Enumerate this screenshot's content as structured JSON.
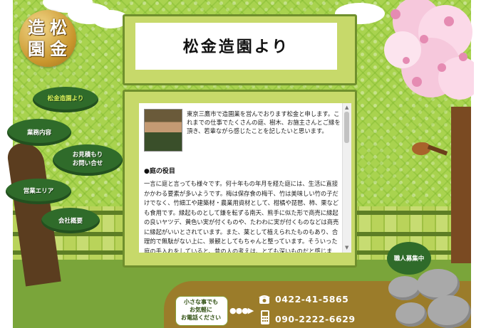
{
  "logo": {
    "chars": [
      "造",
      "松",
      "園",
      "金"
    ]
  },
  "header": {
    "title": "松金造園より"
  },
  "nav": {
    "items": [
      {
        "label": "松金造園より",
        "active": true
      },
      {
        "label": "業務内容"
      },
      {
        "label": "お見積もり\nお問い合せ"
      },
      {
        "label": "営業エリア"
      },
      {
        "label": "会社概要"
      }
    ]
  },
  "content": {
    "intro": "東京三鷹市で造園業を営んでおります松金と申します。これまでの仕事でたくさんの庭、樹木、お施主さんとご縁を頂き、若輩ながら感じたことを記したいと思います。",
    "section_title": "●庭の役目",
    "body": "一言に庭と言っても様々です。何十年もの年月を経た庭には、生活に直接かかわる要素が多いようです。梅は保存食の梅干、竹は美味しい竹の子だけでなく、竹細工や建築材・農業用資材として、柑橘や琵琶、柿、栗なども食用です。縁起ものとして鎌を転ずる南天、熊手に似た形で商売に縁起の良いヤツデ、黄色い実が付くものや、たわわに実が付くものなどは商売に縁起がいいとされています。また、薬として植えられたものもあり、合理的で無駄がない上に、景観としてもちゃんと整っています。そういった庭の手入れをしていると、昔の人の考えは、とても深いものだと感じます。"
  },
  "recruit": {
    "label": "職人募集中"
  },
  "contact": {
    "bubble": "小さな事でも\nお気軽に\nお電話ください",
    "tel": "0422-41-5865",
    "mobile": "090-2222-6629"
  },
  "icons": {
    "phone": "telephone-icon",
    "mobile": "mobile-phone-icon",
    "arrow": "arrow-right-icon"
  },
  "colors": {
    "grass": "#a9d34f",
    "nav_green": "#2f6b2a",
    "nav_active": "#d9f25a",
    "frame": "#6f8f2d"
  }
}
